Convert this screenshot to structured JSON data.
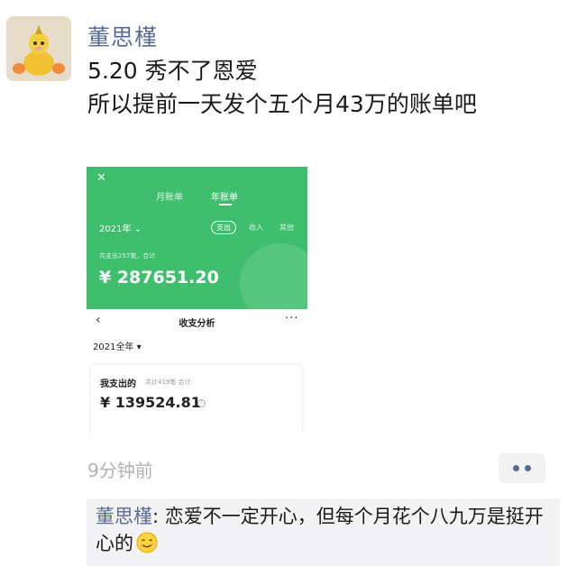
{
  "post": {
    "username": "董思槿",
    "text_line1": "5.20 秀不了恩爱",
    "text_line2": "所以提前一天发个五个月43万的账单吧",
    "timestamp": "9分钟前",
    "more_icon": "ellipsis-icon"
  },
  "screenshot": {
    "close_icon": "close-icon",
    "tabs": [
      {
        "label": "月账单",
        "active": false
      },
      {
        "label": "年账单",
        "active": true
      }
    ],
    "year_selector": "2021年 ⌄",
    "filters": [
      "支出",
      "收入",
      "其他"
    ],
    "count_line": "共支出257笔，合计",
    "total_amount": "¥ 287651.20",
    "nav_back_icon": "chevron-left-icon",
    "nav_title": "收支分析",
    "nav_more": "···",
    "year_all": "2021全年 ▾",
    "card_title": "我支出的",
    "card_count": "共计419笔 合计",
    "card_amount": "¥ 139524.81",
    "card_help": "?"
  },
  "comment": {
    "author": "董思槿",
    "text": ": 恋爱不一定开心，但每个月花个八九万是挺开心的",
    "emoji": "smile-emoji-icon"
  },
  "colors": {
    "link_blue": "#576b95",
    "wechat_green": "#3fbf6e",
    "comment_bg": "#f3f3f5"
  }
}
